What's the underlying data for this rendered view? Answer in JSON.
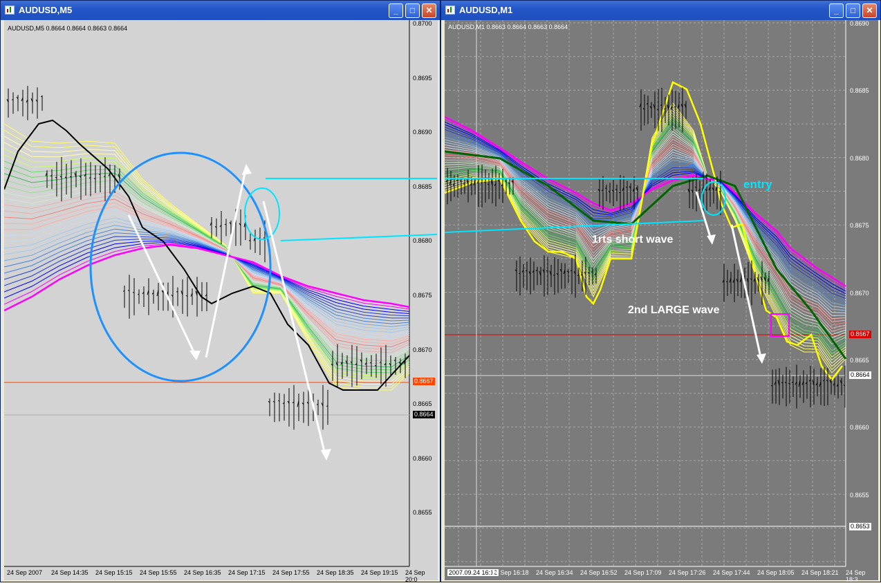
{
  "left_window": {
    "title": "AUDUSD,M5",
    "info_line": "AUDUSD,M5  0.8664 0.8664 0.8663 0.8664",
    "price_ticks": [
      "0.8700",
      "0.8695",
      "0.8690",
      "0.8685",
      "0.8680",
      "0.8675",
      "0.8670",
      "0.8665",
      "0.8660",
      "0.8655"
    ],
    "current_price_label": "0.8667",
    "bid_label": "0.8664",
    "time_ticks": [
      "24 Sep 2007",
      "24 Sep 14:35",
      "24 Sep 15:15",
      "24 Sep 15:55",
      "24 Sep 16:35",
      "24 Sep 17:15",
      "24 Sep 17:55",
      "24 Sep 18:35",
      "24 Sep 19:15",
      "24 Sep 20:0"
    ]
  },
  "right_window": {
    "title": "AUDUSD,M1",
    "info_line": "AUDUSD,M1  0.8663 0.8664 0.8663 0.8664",
    "price_ticks": [
      "0.8690",
      "0.8685",
      "0.8680",
      "0.8675",
      "0.8670",
      "0.8665",
      "0.8660",
      "0.8655"
    ],
    "current_price_label": "0.8667",
    "bid_label": "0.8664",
    "low_label": "0.8653",
    "time_ticks": [
      "2007.09.24 16:12",
      "24 Sep 16:18",
      "24 Sep 16:34",
      "24 Sep 16:52",
      "24 Sep 17:09",
      "24 Sep 17:26",
      "24 Sep 17:44",
      "24 Sep 18:05",
      "24 Sep 18:21",
      "24 Sep 18:3"
    ],
    "annotations": {
      "entry": "entry",
      "short_wave": "1rts short wave",
      "large_wave": "2nd LARGE wave"
    }
  },
  "window_buttons": {
    "minimize": "_",
    "maximize": "□",
    "close": "✕"
  },
  "colors": {
    "title_bar": "#2457c8",
    "left_bg": "#d3d3d3",
    "right_bg": "#7b7b7b",
    "price_line": "#ff4500",
    "ribbon_fast": "#ffff00",
    "ribbon_slow": "#ff00ff",
    "annotation_cyan": "#00e5ff",
    "circle_blue": "#1e90ff"
  }
}
